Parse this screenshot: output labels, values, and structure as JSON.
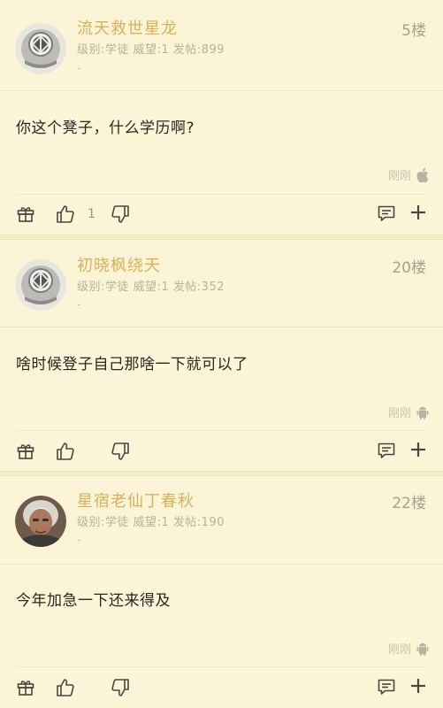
{
  "posts": [
    {
      "username": "流天救世星龙",
      "meta": "级别:学徒 威望:1 发帖:899",
      "dash": "-",
      "floor": "5楼",
      "content": "你这个凳子，什么学历啊?",
      "time": "刚刚",
      "device_icon": "apple-icon",
      "like_count": "1",
      "avatar": "diver-helmet"
    },
    {
      "username": "初晓枫绕天",
      "meta": "级别:学徒 威望:1 发帖:352",
      "dash": "-",
      "floor": "20楼",
      "content": "啥时候登子自己那啥一下就可以了",
      "time": "刚刚",
      "device_icon": "android-icon",
      "like_count": "",
      "avatar": "diver-helmet"
    },
    {
      "username": "星宿老仙丁春秋",
      "meta": "级别:学徒 威望:1 发帖:190",
      "dash": "-",
      "floor": "22楼",
      "content": "今年加急一下还来得及",
      "time": "刚刚",
      "device_icon": "android-icon",
      "like_count": "",
      "avatar": "photo-portrait"
    }
  ],
  "colors": {
    "background": "#fdf7dc",
    "username": "#d8b15a",
    "meta": "#b9b29a",
    "content": "#2a2620",
    "icon": "#4a4640"
  }
}
